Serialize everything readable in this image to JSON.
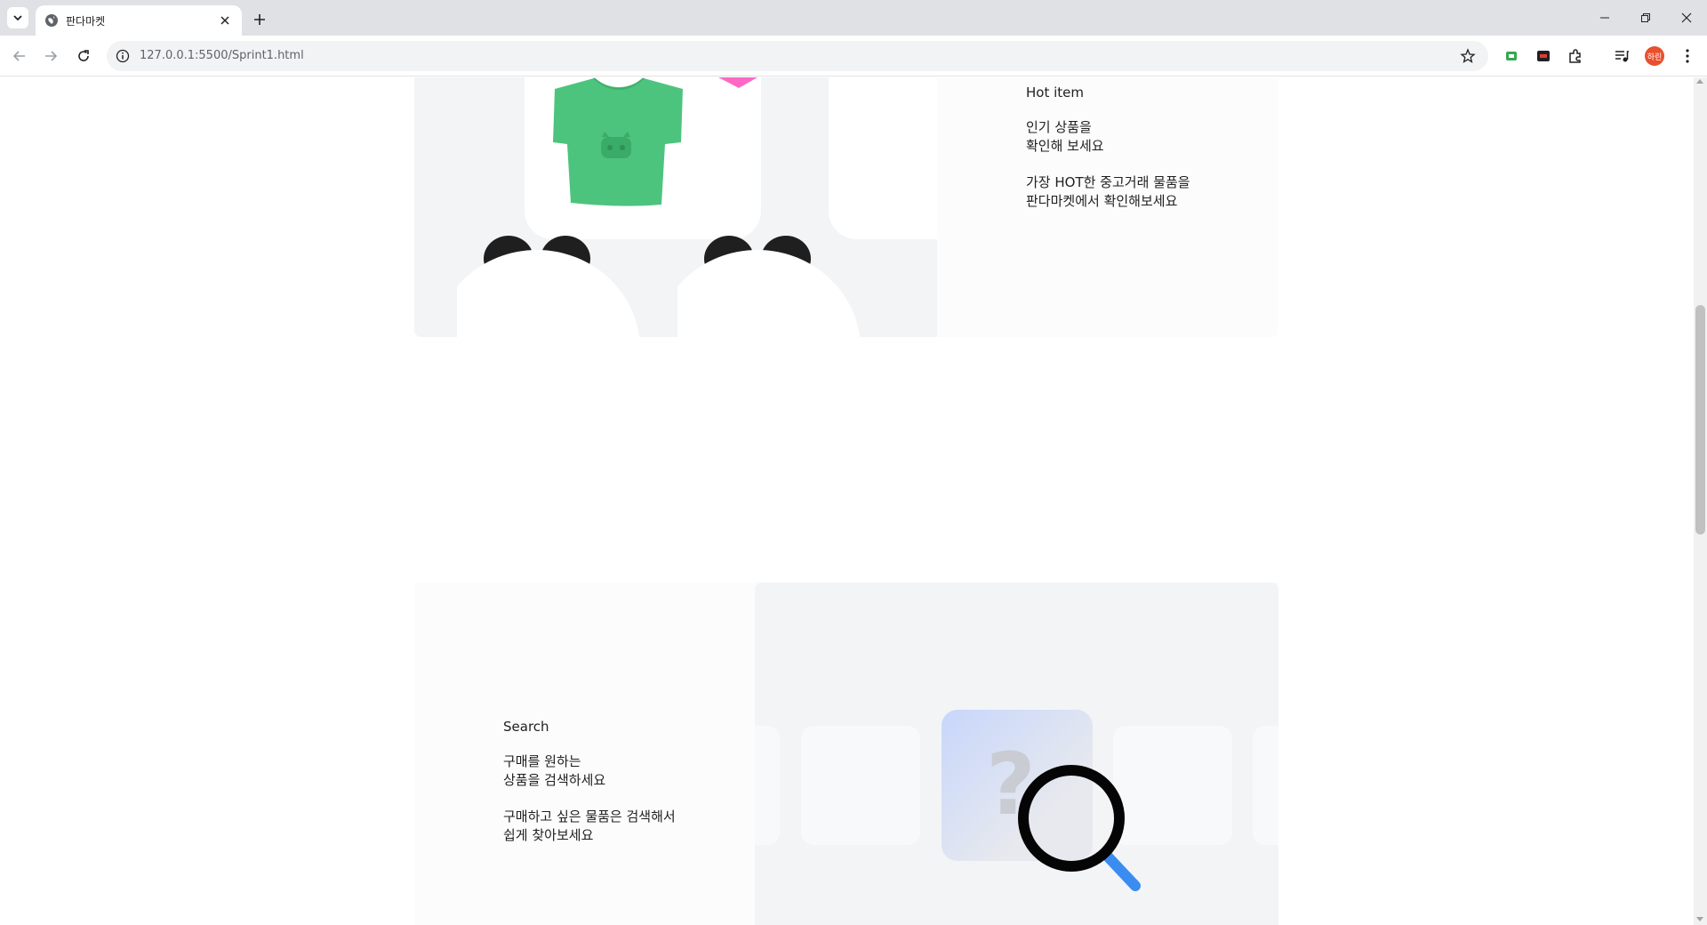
{
  "browser": {
    "tab_title": "판다마켓",
    "url": "127.0.0.1:5500/Sprint1.html",
    "profile_initials": "하린",
    "colors": {
      "tabbar": "#dfe1e5",
      "omnibox": "#f1f3f4",
      "avatar": "#e8502f"
    }
  },
  "page": {
    "hot": {
      "label": "Hot item",
      "title": "인기 상품을\n확인해 보세요",
      "description": "가장 HOT한 중고거래 물품을\n판다마켓에서 확인해보세요"
    },
    "search": {
      "label": "Search",
      "title": "구매를 원하는\n상품을 검색하세요",
      "description": "구매하고 싶은 물품은 검색해서\n쉽게 찾아보세요"
    },
    "colors": {
      "tshirt": "#4cc47e",
      "pink_item": "#ff68c6",
      "panda_ears": "#1f1f1f",
      "magnifier_handle": "#3b8cf0",
      "section_bg": "#fcfcfc",
      "visual_bg": "#f3f4f6"
    }
  }
}
